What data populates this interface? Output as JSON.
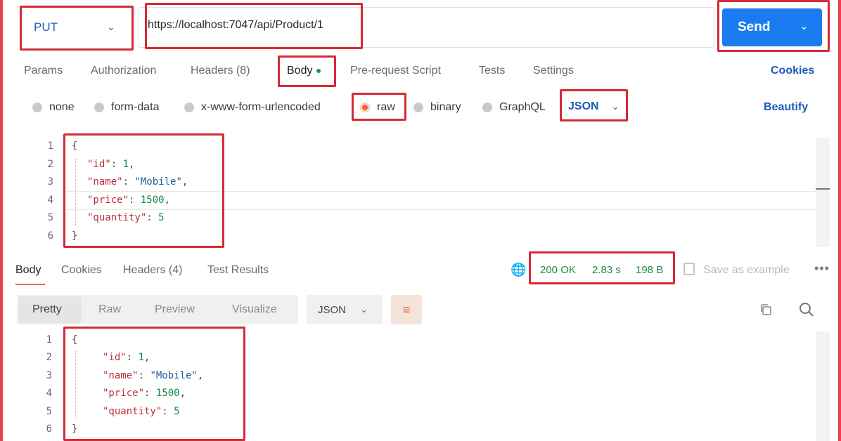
{
  "request": {
    "method": "PUT",
    "url": "https://localhost:7047/api/Product/1",
    "send_label": "Send"
  },
  "request_tabs": [
    {
      "label": "Params"
    },
    {
      "label": "Authorization"
    },
    {
      "label": "Headers (8)"
    },
    {
      "label": "Body"
    },
    {
      "label": "Pre-request Script"
    },
    {
      "label": "Tests"
    },
    {
      "label": "Settings"
    }
  ],
  "cookies_label": "Cookies",
  "body_types": [
    {
      "label": "none"
    },
    {
      "label": "form-data"
    },
    {
      "label": "x-www-form-urlencoded"
    },
    {
      "label": "raw"
    },
    {
      "label": "binary"
    },
    {
      "label": "GraphQL"
    }
  ],
  "body_format": "JSON",
  "beautify_label": "Beautify",
  "request_body": {
    "line_numbers": [
      "1",
      "2",
      "3",
      "4",
      "5",
      "6"
    ],
    "open": "{",
    "close": "}",
    "fields": [
      {
        "key": "\"id\"",
        "sep": ": ",
        "value": "1",
        "trail": ","
      },
      {
        "key": "\"name\"",
        "sep": ": ",
        "value": "\"Mobile\"",
        "trail": ","
      },
      {
        "key": "\"price\"",
        "sep": ": ",
        "value": "1500",
        "trail": ","
      },
      {
        "key": "\"quantity\"",
        "sep": ": ",
        "value": "5",
        "trail": ""
      }
    ]
  },
  "response_tabs": [
    {
      "label": "Body"
    },
    {
      "label": "Cookies"
    },
    {
      "label": "Headers (4)"
    },
    {
      "label": "Test Results"
    }
  ],
  "response_status": {
    "code": "200 OK",
    "time": "2.83 s",
    "size": "198 B"
  },
  "save_example_label": "Save as example",
  "more_label": "•••",
  "view_modes": [
    {
      "label": "Pretty"
    },
    {
      "label": "Raw"
    },
    {
      "label": "Preview"
    },
    {
      "label": "Visualize"
    }
  ],
  "response_format": "JSON",
  "response_body": {
    "line_numbers": [
      "1",
      "2",
      "3",
      "4",
      "5",
      "6"
    ],
    "open": "{",
    "close": "}",
    "fields": [
      {
        "key": "\"id\"",
        "sep": ": ",
        "value": "1",
        "trail": ","
      },
      {
        "key": "\"name\"",
        "sep": ": ",
        "value": "\"Mobile\"",
        "trail": ","
      },
      {
        "key": "\"price\"",
        "sep": ": ",
        "value": "1500",
        "trail": ","
      },
      {
        "key": "\"quantity\"",
        "sep": ": ",
        "value": "5",
        "trail": ""
      }
    ]
  },
  "colors": {
    "accent": "#1a7cf0",
    "highlight": "#d62a35",
    "status_ok": "#1b8f44",
    "active_tab": "#f26b3a"
  },
  "icons": {
    "method_dropdown": "chevron-down-icon",
    "send_dropdown": "chevron-down-icon",
    "status": "globe-icon",
    "save": "save-icon",
    "wrap": "wrap-lines-icon",
    "copy": "copy-icon",
    "search": "search-icon"
  }
}
